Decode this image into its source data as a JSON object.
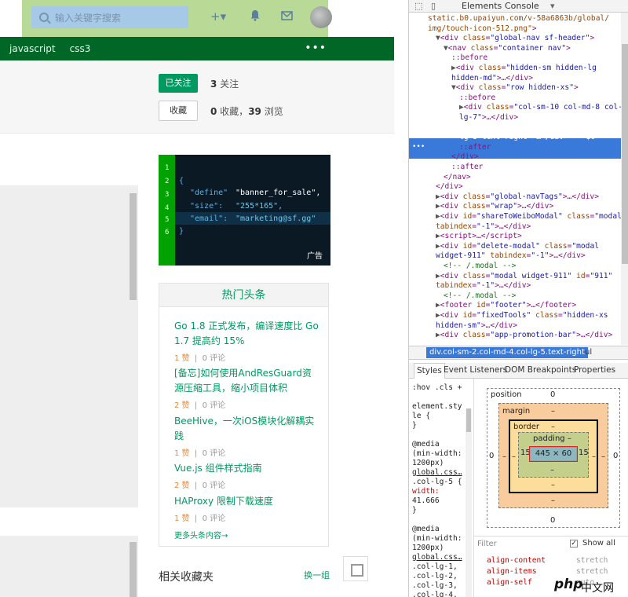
{
  "header": {
    "search_placeholder": "输入关键字搜索",
    "plus_label": "+▾",
    "nav_tags": [
      "javascript",
      "css3"
    ],
    "more_label": "•••"
  },
  "tag_actions": {
    "follow_label": "已关注",
    "follow_count": "3",
    "follow_suffix": " 关注",
    "fav_label": "收藏",
    "fav_count": "0",
    "fav_suffix": " 收藏，",
    "view_count": "39",
    "view_suffix": " 浏览"
  },
  "ad": {
    "line_numbers": [
      "1",
      "2",
      "3",
      "4",
      "5",
      "6"
    ],
    "lines": {
      "l2": "{",
      "l3_key": "\"define\"",
      "l3_val": "\"banner_for_sale\",",
      "l4_key": "\"size\":",
      "l4_val": "\"255*165\",",
      "l5_key": "\"email\":",
      "l5_val": "\"marketing@sf.gg\"",
      "l6": "}"
    },
    "label": "广告"
  },
  "hot_news": {
    "title": "热门头条",
    "items": [
      {
        "title": "Go 1.8 正式发布，编译速度比 Go 1.7 提高约 15%",
        "likes": "1 赞",
        "comments": "0 评论"
      },
      {
        "title": "[备忘]如何使用AndResGuard资源压缩工具，缩小项目体积",
        "likes": "2 赞",
        "comments": "0 评论"
      },
      {
        "title": "BeeHive，一次iOS模块化解耦实践",
        "likes": "1 赞",
        "comments": "0 评论"
      },
      {
        "title": "Vue.js 组件样式指南",
        "likes": "2 赞",
        "comments": "0 评论"
      },
      {
        "title": "HAProxy 限制下载速度",
        "likes": "1 赞",
        "comments": "0 评论"
      }
    ],
    "more_label": "更多头条内容→"
  },
  "related": {
    "title": "相关收藏夹",
    "switch_label": "换一组"
  },
  "devtools": {
    "tabs": [
      "Elements",
      "Console",
      "▾"
    ],
    "dom_lines": [
      {
        "indent": 0,
        "html": "<span class='an'>static.b0.upaiyun.com/v-58a6863b/global/</span>"
      },
      {
        "indent": 0,
        "html": "<span class='an'>img/touch-icon-512.png\"</span><span class='tag'>&gt;</span>"
      },
      {
        "indent": 1,
        "html": "<span class='tri'>▼</span><span class='tag'>&lt;div </span><span class='an'>class</span>=<span class='av'>\"global-nav sf-header\"</span><span class='tag'>&gt;</span>"
      },
      {
        "indent": 2,
        "html": "<span class='tri'>▼</span><span class='tag'>&lt;nav </span><span class='an'>class</span>=<span class='av'>\"container nav\"</span><span class='tag'>&gt;</span>"
      },
      {
        "indent": 3,
        "html": "<span class='ps'>::before</span>"
      },
      {
        "indent": 3,
        "html": "<span class='tri'>▶</span><span class='tag'>&lt;div </span><span class='an'>class</span>=<span class='av'>\"hidden-sm hidden-lg</span>"
      },
      {
        "indent": 3,
        "html": "<span class='av'>hidden-md\"</span><span class='tag'>&gt;</span>…<span class='tag'>&lt;/div&gt;</span>"
      },
      {
        "indent": 3,
        "html": "<span class='tri'>▼</span><span class='tag'>&lt;div </span><span class='an'>class</span>=<span class='av'>\"row hidden-xs\"</span><span class='tag'>&gt;</span>"
      },
      {
        "indent": 4,
        "html": "<span class='ps'>::before</span>"
      },
      {
        "indent": 4,
        "html": "<span class='tri'>▶</span><span class='tag'>&lt;div </span><span class='an'>class</span>=<span class='av'>\"col-sm-10 col-md-8 col-</span>"
      },
      {
        "indent": 4,
        "html": "<span class='av'>lg-7\"</span><span class='tag'>&gt;</span>…<span class='tag'>&lt;/div&gt;</span>"
      },
      {
        "indent": 4,
        "html": "<span style='color:#fff'>▶ &lt;div class=\"col-sm-2 col-md-4 col-</span>"
      },
      {
        "indent": 4,
        "html": "<span style='color:#fff'>lg-5 text-right\"&gt;…&lt;/div&gt; == $0</span>"
      },
      {
        "indent": 4,
        "html": "<span class='ps'>::after</span>"
      },
      {
        "indent": 3,
        "html": "<span class='tag'>&lt;/div&gt;</span>"
      },
      {
        "indent": 3,
        "html": "<span class='ps'>::after</span>"
      },
      {
        "indent": 2,
        "html": "<span class='tag'>&lt;/nav&gt;</span>"
      },
      {
        "indent": 1,
        "html": "<span class='tag'>&lt;/div&gt;</span>"
      },
      {
        "indent": 1,
        "html": "<span class='tri'>▶</span><span class='tag'>&lt;div </span><span class='an'>class</span>=<span class='av'>\"global-navTags\"</span><span class='tag'>&gt;</span>…<span class='tag'>&lt;/div&gt;</span>"
      },
      {
        "indent": 1,
        "html": "<span class='tri'>▶</span><span class='tag'>&lt;div </span><span class='an'>class</span>=<span class='av'>\"wrap\"</span><span class='tag'>&gt;</span>…<span class='tag'>&lt;/div&gt;</span>"
      },
      {
        "indent": 1,
        "html": "<span class='tri'>▶</span><span class='tag'>&lt;div </span><span class='an'>id</span>=<span class='av'>\"shareToWeiboModal\"</span> <span class='an'>class</span>=<span class='av'>\"modal\"</span>"
      },
      {
        "indent": 1,
        "html": "<span class='an'>tabindex</span>=<span class='av'>\"-1\"</span><span class='tag'>&gt;</span>…<span class='tag'>&lt;/div&gt;</span>"
      },
      {
        "indent": 1,
        "html": "<span class='tri'>▶</span><span class='tag'>&lt;script&gt;</span>…<span class='tag'>&lt;/script&gt;</span>"
      },
      {
        "indent": 1,
        "html": "<span class='tri'>▶</span><span class='tag'>&lt;div </span><span class='an'>id</span>=<span class='av'>\"delete-modal\"</span> <span class='an'>class</span>=<span class='av'>\"modal</span>"
      },
      {
        "indent": 1,
        "html": "<span class='av'>widget-911\"</span> <span class='an'>tabindex</span>=<span class='av'>\"-1\"</span><span class='tag'>&gt;</span>…<span class='tag'>&lt;/div&gt;</span>"
      },
      {
        "indent": 2,
        "html": "<span class='cm'>&lt;!-- /.modal --&gt;</span>"
      },
      {
        "indent": 1,
        "html": "<span class='tri'>▶</span><span class='tag'>&lt;div </span><span class='an'>class</span>=<span class='av'>\"modal widget-911\"</span> <span class='an'>id</span>=<span class='av'>\"911\"</span>"
      },
      {
        "indent": 1,
        "html": "<span class='an'>tabindex</span>=<span class='av'>\"-1\"</span><span class='tag'>&gt;</span>…<span class='tag'>&lt;/div&gt;</span>"
      },
      {
        "indent": 2,
        "html": "<span class='cm'>&lt;!-- /.modal --&gt;</span>"
      },
      {
        "indent": 1,
        "html": "<span class='tri'>▶</span><span class='tag'>&lt;footer </span><span class='an'>id</span>=<span class='av'>\"footer\"</span><span class='tag'>&gt;</span>…<span class='tag'>&lt;/footer&gt;</span>"
      },
      {
        "indent": 1,
        "html": "<span class='tri'>▶</span><span class='tag'>&lt;div </span><span class='an'>id</span>=<span class='av'>\"fixedTools\"</span> <span class='an'>class</span>=<span class='av'>\"hidden-xs</span>"
      },
      {
        "indent": 1,
        "html": "<span class='av'>hidden-sm\"</span><span class='tag'>&gt;</span>…<span class='tag'>&lt;/div&gt;</span>"
      },
      {
        "indent": 1,
        "html": "<span class='tri'>▶</span><span class='tag'>&lt;div </span><span class='an'>class</span>=<span class='av'>\"app-promotion-bar\"</span><span class='tag'>&gt;</span>…<span class='tag'>&lt;/div&gt;</span>"
      }
    ],
    "breadcrumb_selected": "div.col-sm-2.col-md-4.col-lg-5.text-right",
    "breadcrumb_next": "ul",
    "styles_tabs": [
      "Styles",
      "Event Listeners",
      "DOM Breakpoints",
      "Properties"
    ],
    "styles_lines": [
      ":hov .cls  +",
      "",
      "element.sty",
      "le {",
      "}",
      "",
      "@media",
      "(min-width:",
      "1200px)",
      "global.css…",
      ".col-lg-5 {",
      "  width:",
      "     41.666",
      "}",
      "",
      "@media",
      "(min-width:",
      "1200px)",
      "global.css…",
      ".col-lg-1,",
      ".col-lg-2,",
      ".col-lg-3,",
      ".col-lg-4,"
    ],
    "box_model": {
      "position_label": "position",
      "position_top": "0",
      "position_bottom": "0",
      "position_left": "0",
      "position_right": "0",
      "margin_label": "margin",
      "margin_top": "–",
      "margin_bottom": "–",
      "margin_left": "–",
      "margin_right": "–",
      "border_label": "border",
      "border_top": "–",
      "border_bottom": "–",
      "border_left": "–",
      "border_right": "–",
      "padding_label": "padding –",
      "padding_bottom": "–",
      "padding_left": "15",
      "padding_right": "15",
      "content": "445 × 60"
    },
    "filter_placeholder": "Filter",
    "show_all_label": "Show all",
    "show_all_checked": "✓",
    "computed": [
      {
        "prop": "align-content",
        "val": "stretch"
      },
      {
        "prop": "align-items",
        "val": "stretch"
      },
      {
        "prop": "align-self",
        "val": "auto"
      }
    ]
  },
  "watermark": {
    "logo": "php",
    "text": "中文网"
  }
}
